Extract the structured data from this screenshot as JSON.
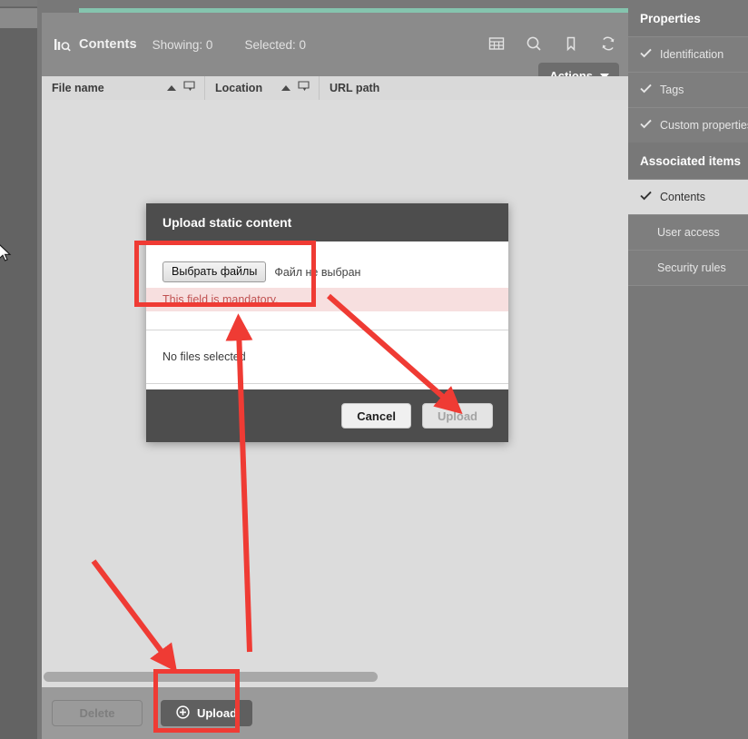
{
  "theme": {
    "accent_teal": "#85c4ae",
    "annotation_red": "#ef3b34",
    "panel_grey": "#8b8b8b",
    "dialog_header_grey": "#4d4d4d",
    "error_pink": "#f7dfdf",
    "error_text": "#c05050"
  },
  "contents_panel": {
    "icon": "bar-chart-search-icon",
    "title": "Contents",
    "showing_label": "Showing: 0",
    "selected_label": "Selected: 0",
    "toolbar_icons": [
      {
        "name": "table-view-icon"
      },
      {
        "name": "search-icon"
      },
      {
        "name": "bookmark-icon"
      },
      {
        "name": "refresh-icon"
      }
    ],
    "actions_button": "Actions",
    "columns": [
      {
        "label": "File name",
        "sort": "asc",
        "filter": true
      },
      {
        "label": "Location",
        "sort": "asc",
        "filter": true
      },
      {
        "label": "URL path",
        "sort": null,
        "filter": false
      }
    ],
    "rows": []
  },
  "footer": {
    "delete_button": "Delete",
    "upload_button": "Upload",
    "upload_icon": "plus-circle-icon"
  },
  "properties_rail": {
    "properties_title": "Properties",
    "properties_items": [
      {
        "label": "Identification",
        "checked": true
      },
      {
        "label": "Tags",
        "checked": true
      },
      {
        "label": "Custom properties",
        "checked": true
      }
    ],
    "associated_title": "Associated items",
    "associated_items": [
      {
        "label": "Contents",
        "checked": true,
        "selected": true
      },
      {
        "label": "User access",
        "checked": false,
        "selected": false
      },
      {
        "label": "Security rules",
        "checked": false,
        "selected": false
      }
    ]
  },
  "dialog": {
    "title": "Upload static content",
    "file_input": {
      "button_label": "Выбрать файлы",
      "status_text": "Файл не выбран"
    },
    "error_message": "This field is mandatory.",
    "no_files_text": "No files selected",
    "cancel_button": "Cancel",
    "upload_button": "Upload",
    "upload_disabled": true
  },
  "annotations": {
    "boxes": [
      {
        "name": "file-input-highlight"
      },
      {
        "name": "upload-button-highlight"
      }
    ],
    "arrows": [
      {
        "name": "arrow-to-dialog-upload"
      },
      {
        "name": "arrow-to-dialog-body"
      },
      {
        "name": "arrow-to-footer-upload"
      }
    ]
  }
}
